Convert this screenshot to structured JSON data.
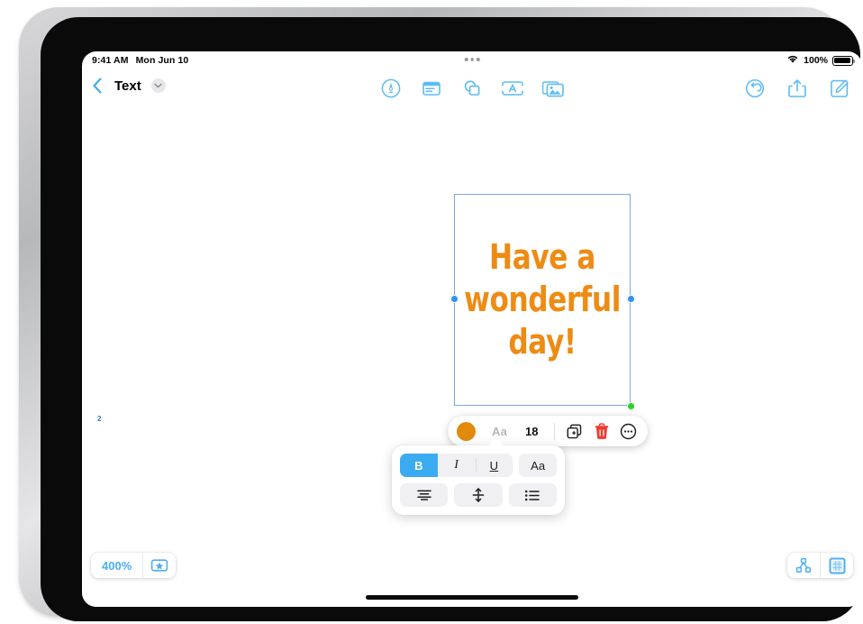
{
  "status_bar": {
    "time": "9:41 AM",
    "date": "Mon Jun 10",
    "wifi_icon": "wifi-icon",
    "battery_percent": "100%",
    "multitask_dots": "multitasking-dots-icon"
  },
  "nav_bar": {
    "back_icon": "chevron-left-icon",
    "document_title": "Text",
    "title_chevron_icon": "chevron-down-icon",
    "center_tools": [
      {
        "name": "markup-pen-tool",
        "icon": "pen-in-circle-icon"
      },
      {
        "name": "sticky-note-tool",
        "icon": "note-card-icon"
      },
      {
        "name": "shapes-tool",
        "icon": "overlapping-shapes-icon"
      },
      {
        "name": "text-box-tool",
        "icon": "text-box-icon"
      },
      {
        "name": "media-tool",
        "icon": "photos-stack-icon"
      }
    ],
    "right_tools": [
      {
        "name": "undo-button",
        "icon": "undo-arrow-icon"
      },
      {
        "name": "share-button",
        "icon": "share-up-arrow-icon"
      },
      {
        "name": "compose-button",
        "icon": "compose-pencil-square-icon"
      }
    ]
  },
  "canvas": {
    "text_object": {
      "content": "Have a\nwonderful\nday!",
      "color": "#ee8b14",
      "selection_border_color": "#7aa7e8",
      "handles": [
        {
          "name": "resize-handle-left",
          "color": "#2f93f0"
        },
        {
          "name": "resize-handle-right",
          "color": "#2f93f0"
        },
        {
          "name": "resize-handle-bottom-right",
          "color": "#25d321"
        }
      ]
    },
    "edge_marker": "2"
  },
  "format_bar": {
    "color_swatch": "#e18a0c",
    "font_label": "Aa",
    "font_size": "18",
    "duplicate_icon": "duplicate-icon",
    "delete_icon": "trash-icon",
    "delete_color": "#ef3b30",
    "more_icon": "more-ellipsis-circle-icon"
  },
  "style_panel": {
    "row1": [
      {
        "name": "bold-button",
        "label": "B",
        "active": true
      },
      {
        "name": "italic-button",
        "label": "I",
        "active": false
      },
      {
        "name": "underline-button",
        "label": "U",
        "active": false
      },
      {
        "name": "font-style-button",
        "label": "Aa",
        "active": false
      }
    ],
    "row2": [
      {
        "name": "align-center-button",
        "icon": "align-center-icon"
      },
      {
        "name": "line-spacing-button",
        "icon": "line-spacing-icon"
      },
      {
        "name": "bullet-list-button",
        "icon": "bullet-list-icon"
      }
    ],
    "active_color": "#3aabf0"
  },
  "bottom_bar": {
    "zoom_level": "400%",
    "favorite_icon": "star-in-rectangle-icon",
    "connections_icon": "node-graph-icon",
    "grid_icon": "grid-square-icon"
  }
}
